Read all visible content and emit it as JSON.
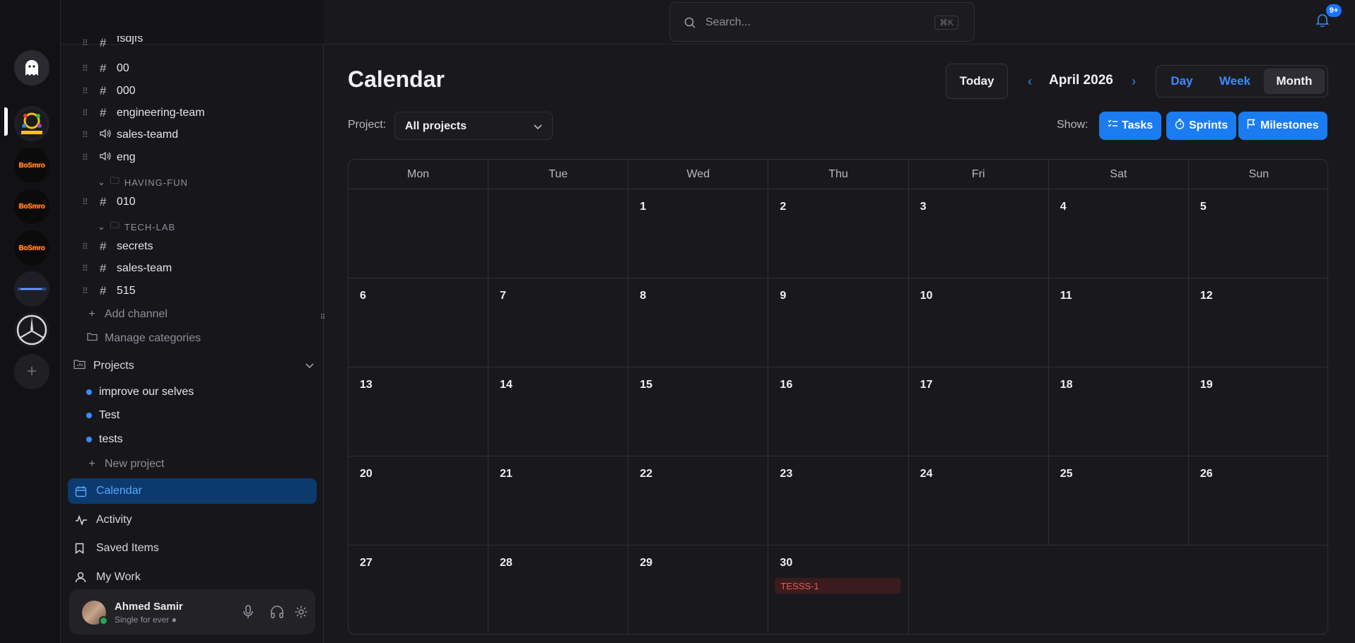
{
  "servers": [
    {
      "name": "ghost-server",
      "kind": "ghost"
    },
    {
      "name": "lakers-server",
      "kind": "image"
    },
    {
      "name": "bosmro-1",
      "kind": "bosmro",
      "text": "BoSmro"
    },
    {
      "name": "bosmro-2",
      "kind": "bosmro",
      "text": "BoSmro"
    },
    {
      "name": "bosmro-3",
      "kind": "bosmro",
      "text": "BoSmro"
    },
    {
      "name": "tech-server",
      "kind": "tech"
    },
    {
      "name": "mercedes-server",
      "kind": "mercedes"
    }
  ],
  "sidebar": {
    "channels": [
      {
        "label": "fsdjfs",
        "type": "text"
      },
      {
        "label": "00",
        "type": "text"
      },
      {
        "label": "000",
        "type": "text"
      },
      {
        "label": "engineering-team",
        "type": "text"
      },
      {
        "label": "sales-teamd",
        "type": "voice"
      },
      {
        "label": "eng",
        "type": "voice"
      }
    ],
    "category_having_fun": "HAVING-FUN",
    "channels_having_fun": [
      {
        "label": "010",
        "type": "text"
      }
    ],
    "category_tech_lab": "TECH-LAB",
    "channels_tech_lab": [
      {
        "label": "secrets",
        "type": "text"
      },
      {
        "label": "sales-team",
        "type": "text"
      },
      {
        "label": "515",
        "type": "text"
      }
    ],
    "add_channel": "Add channel",
    "manage_categories": "Manage categories",
    "projects_header": "Projects",
    "projects": [
      "improve our selves",
      "Test",
      "tests"
    ],
    "new_project": "New project",
    "nav": {
      "calendar": "Calendar",
      "activity": "Activity",
      "saved": "Saved Items",
      "my_work": "My Work"
    },
    "user": {
      "name": "Ahmed Samir",
      "status": "Single for ever"
    }
  },
  "topbar": {
    "search_placeholder": "Search...",
    "shortcut": "⌘K",
    "notifications": "9+"
  },
  "calendar": {
    "title": "Calendar",
    "today": "Today",
    "month_label": "April 2026",
    "views": {
      "day": "Day",
      "week": "Week",
      "month": "Month",
      "selected": "month"
    },
    "project_label": "Project:",
    "project_value": "All projects",
    "show_label": "Show:",
    "filters": {
      "tasks": "Tasks",
      "sprints": "Sprints",
      "milestones": "Milestones"
    },
    "weekdays": [
      "Mon",
      "Tue",
      "Wed",
      "Thu",
      "Fri",
      "Sat",
      "Sun"
    ],
    "weeks": [
      [
        "",
        "",
        "1",
        "2",
        "3",
        "4",
        "5"
      ],
      [
        "6",
        "7",
        "8",
        "9",
        "10",
        "11",
        "12"
      ],
      [
        "13",
        "14",
        "15",
        "16",
        "17",
        "18",
        "19"
      ],
      [
        "20",
        "21",
        "22",
        "23",
        "24",
        "25",
        "26"
      ],
      [
        "27",
        "28",
        "29",
        "30",
        "",
        "",
        ""
      ]
    ],
    "events": [
      {
        "week": 4,
        "day": 3,
        "label": "TESSS-1",
        "color": "#ef5a4c"
      }
    ]
  },
  "colors": {
    "accent": "#1a7cf0",
    "active_nav_bg": "#0c3a6e",
    "event_bg": "#3a1c1e"
  }
}
